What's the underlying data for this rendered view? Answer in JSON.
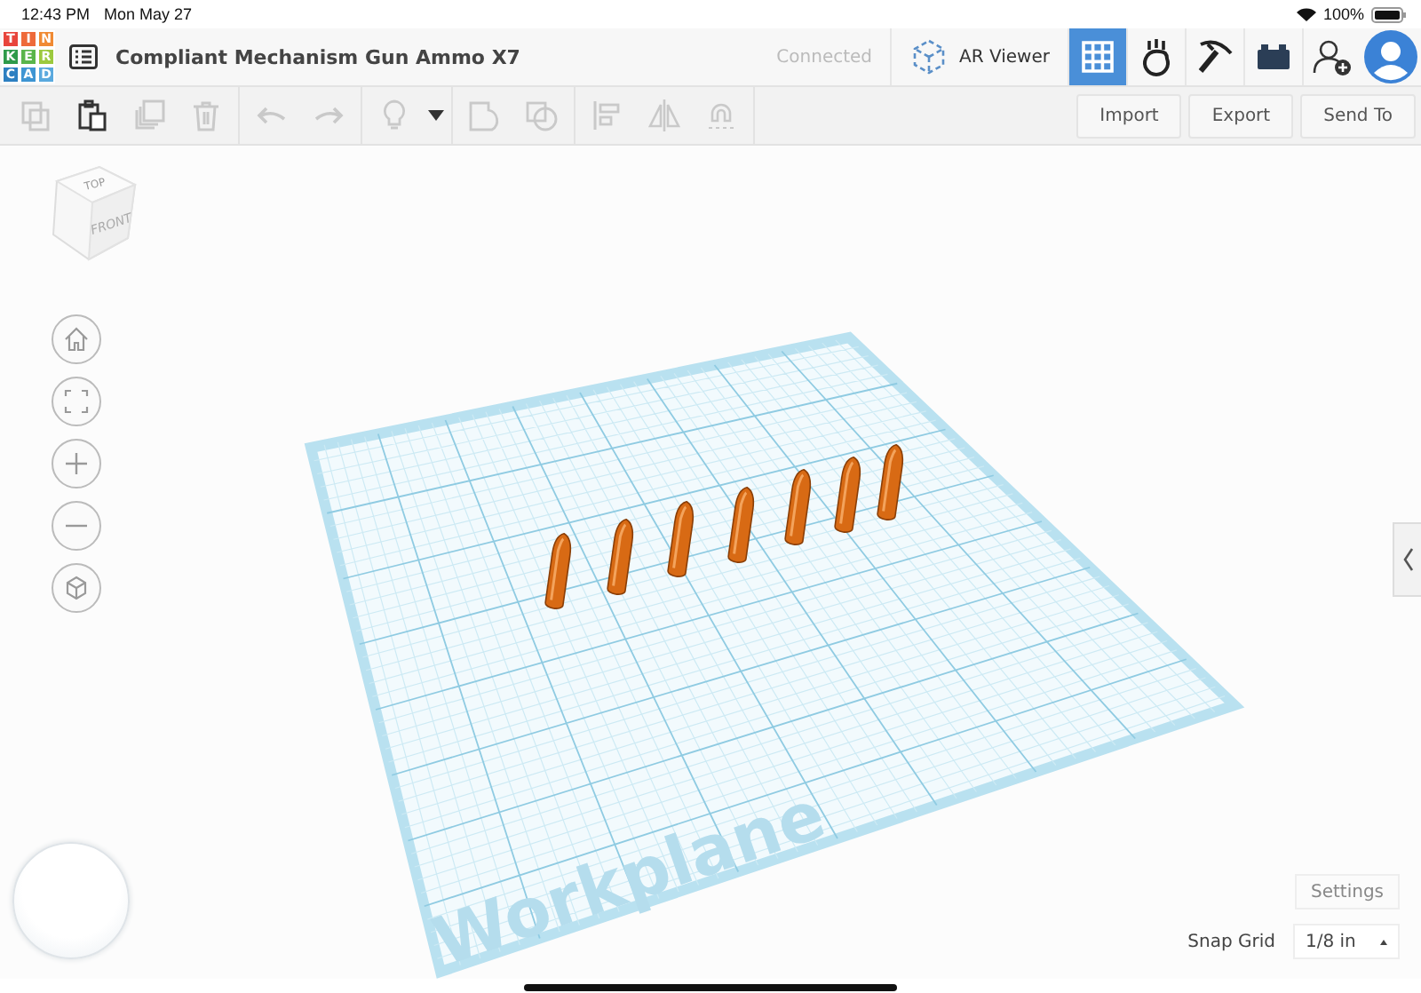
{
  "status_bar": {
    "time": "12:43 PM",
    "date": "Mon May 27",
    "battery": "100%"
  },
  "header": {
    "logo_letters": [
      {
        "letter": "T",
        "color": "#e8453c"
      },
      {
        "letter": "I",
        "color": "#ee6a3a"
      },
      {
        "letter": "N",
        "color": "#f08a33"
      },
      {
        "letter": "K",
        "color": "#2e9a4a"
      },
      {
        "letter": "E",
        "color": "#5ab54b"
      },
      {
        "letter": "R",
        "color": "#9cc93e"
      },
      {
        "letter": "C",
        "color": "#2d7fc1"
      },
      {
        "letter": "A",
        "color": "#3e95d3"
      },
      {
        "letter": "D",
        "color": "#5aa9de"
      }
    ],
    "title": "Compliant Mechanism Gun Ammo X7",
    "connection": "Connected",
    "ar_button": "AR Viewer",
    "views": [
      {
        "kind": "grid",
        "selected": true
      },
      {
        "kind": "hand",
        "selected": false
      },
      {
        "kind": "pickaxe",
        "selected": false
      },
      {
        "kind": "brick",
        "selected": false
      }
    ]
  },
  "toolbar": {
    "tools": [
      {
        "kind": "copy",
        "disabled": true
      },
      {
        "kind": "paste",
        "disabled": false
      },
      {
        "kind": "duplicate",
        "disabled": true
      },
      {
        "kind": "delete",
        "disabled": true
      },
      {
        "kind": "undo",
        "disabled": true
      },
      {
        "kind": "redo",
        "disabled": true
      },
      {
        "kind": "light",
        "disabled": true
      },
      {
        "kind": "dropdown",
        "disabled": false
      },
      {
        "kind": "group",
        "disabled": true
      },
      {
        "kind": "ungroup",
        "disabled": true
      },
      {
        "kind": "align",
        "disabled": true
      },
      {
        "kind": "mirror",
        "disabled": true
      },
      {
        "kind": "magnet",
        "disabled": true
      }
    ],
    "buttons": [
      "Import",
      "Export",
      "Send To"
    ]
  },
  "view_cube": {
    "top": "TOP",
    "front": "FRONT"
  },
  "workplane": {
    "label": "Workplane"
  },
  "settings_button": "Settings",
  "snap_grid": {
    "label": "Snap Grid",
    "value": "1/8 in"
  }
}
